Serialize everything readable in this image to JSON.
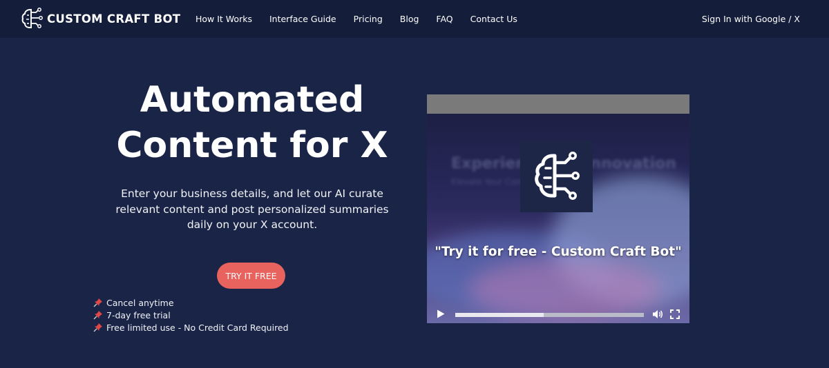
{
  "brand": {
    "name": "CUSTOM CRAFT BOT",
    "logo_icon": "brain-circuit-icon"
  },
  "nav": {
    "links": [
      "How It Works",
      "Interface Guide",
      "Pricing",
      "Blog",
      "FAQ",
      "Contact Us"
    ],
    "signin": "Sign In with Google / X"
  },
  "hero": {
    "title_line1": "Automated",
    "title_line2": "Content for X",
    "description": "Enter your business details, and let our AI curate relevant content and post personalized summaries daily on your X account.",
    "cta": "TRY IT FREE",
    "perks": [
      "Cancel anytime",
      "7-day free trial",
      "Free limited use - No Credit Card Required"
    ],
    "perk_icon": "pushpin-icon"
  },
  "video": {
    "caption": "\"Try it for free - Custom Craft Bot\"",
    "background_title": "Experience the Innovation",
    "background_subtitle": "Elevate Your Content Effortlessly",
    "progress": 0.47
  },
  "colors": {
    "background": "#1a2447",
    "nav_background": "#141d3a",
    "accent": "#e8625e"
  }
}
